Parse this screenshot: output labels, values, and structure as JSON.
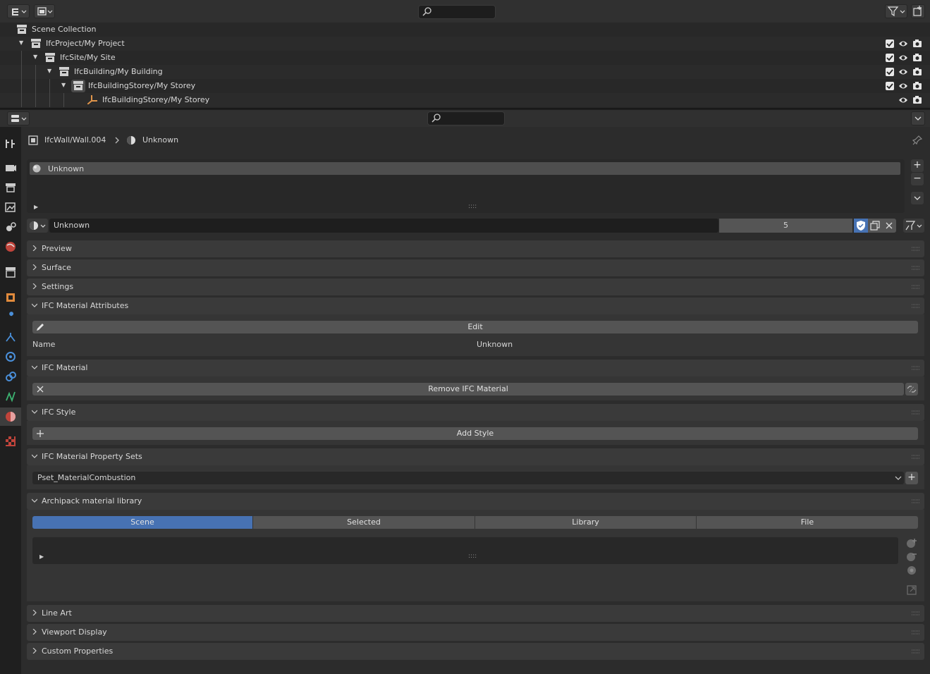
{
  "outliner": {
    "rows": [
      {
        "label": "Scene Collection"
      },
      {
        "label": "IfcProject/My Project"
      },
      {
        "label": "IfcSite/My Site"
      },
      {
        "label": "IfcBuilding/My Building"
      },
      {
        "label": "IfcBuildingStorey/My Storey"
      },
      {
        "label": "IfcBuildingStorey/My Storey"
      }
    ]
  },
  "breadcrumb": {
    "object": "IfcWall/Wall.004",
    "material": "Unknown"
  },
  "slot_list": {
    "items": [
      "Unknown"
    ]
  },
  "material_selector": {
    "name": "Unknown",
    "users": "5"
  },
  "panels": {
    "preview": "Preview",
    "surface": "Surface",
    "settings": "Settings",
    "ifc_material_attributes": {
      "title": "IFC Material Attributes",
      "edit": "Edit",
      "name_label": "Name",
      "name_value": "Unknown"
    },
    "ifc_material": {
      "title": "IFC Material",
      "remove": "Remove IFC Material"
    },
    "ifc_style": {
      "title": "IFC Style",
      "add": "Add Style"
    },
    "ifc_pset": {
      "title": "IFC Material Property Sets",
      "selected": "Pset_MaterialCombustion"
    },
    "archipack": {
      "title": "Archipack material library",
      "tabs": [
        "Scene",
        "Selected",
        "Library",
        "File"
      ],
      "active_tab": "Scene"
    },
    "line_art": "Line Art",
    "viewport_display": "Viewport Display",
    "custom_properties": "Custom Properties"
  },
  "colors": {
    "accent": "#4772b3",
    "background": "#303030",
    "panel_header": "#3a3a3a"
  }
}
